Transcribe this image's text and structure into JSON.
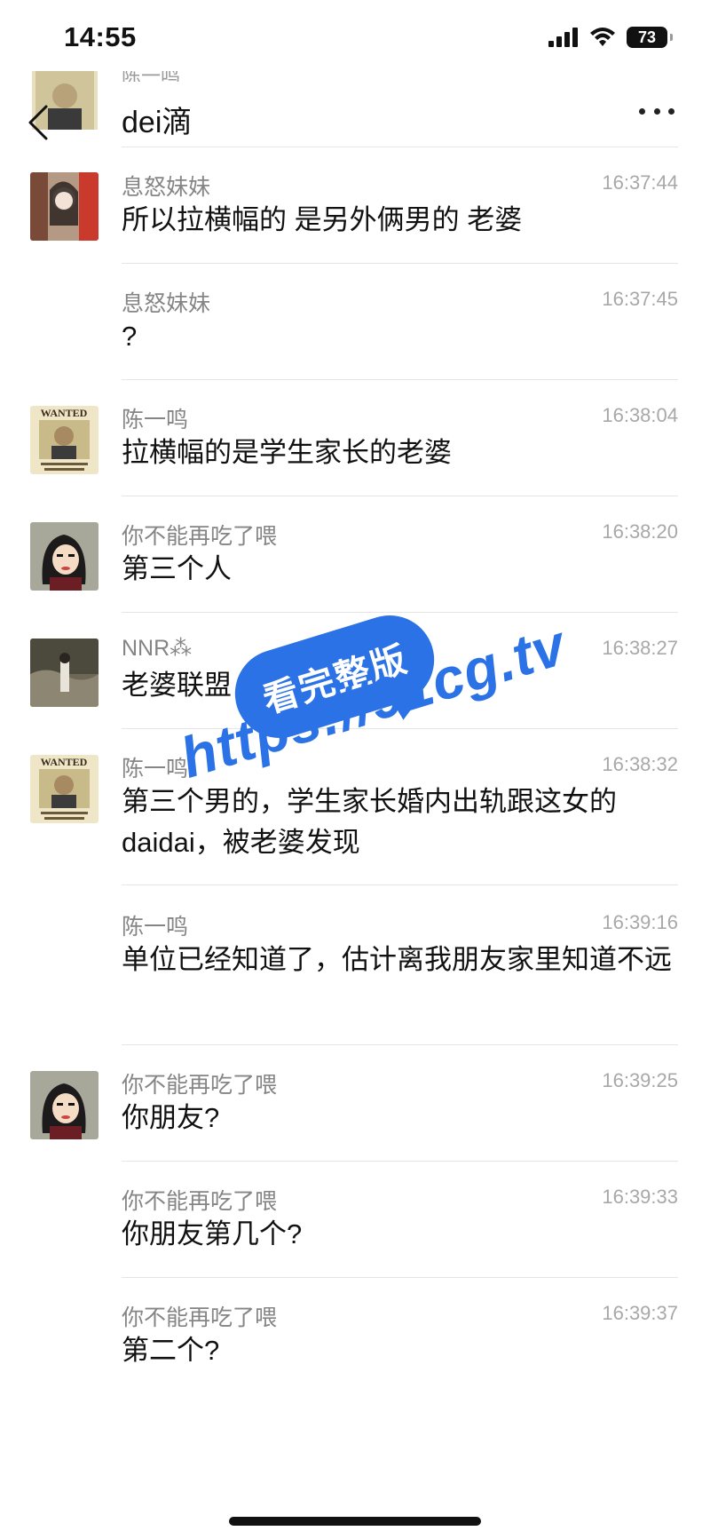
{
  "status_bar": {
    "time": "14:55",
    "battery": "73"
  },
  "header": {
    "title": "dei滴",
    "subtitle": "陈一鸣"
  },
  "messages": [
    {
      "sender": "息怒妹妹",
      "time": "16:37:44",
      "text": "所以拉横幅的 是另外俩男的 老婆",
      "avatar": "photo-avatar"
    },
    {
      "sender": "息怒妹妹",
      "time": "16:37:45",
      "text": "?",
      "avatar": ""
    },
    {
      "sender": "陈一鸣",
      "time": "16:38:04",
      "text": "拉横幅的是学生家长的老婆",
      "avatar": "wanted-poster-avatar"
    },
    {
      "sender": "你不能再吃了喂",
      "time": "16:38:20",
      "text": "第三个人",
      "avatar": "cartoon-avatar"
    },
    {
      "sender": "NNR⁂",
      "time": "16:38:27",
      "text": "老婆联盟",
      "avatar": "photo-avatar"
    },
    {
      "sender": "陈一鸣",
      "time": "16:38:32",
      "text": "第三个男的，学生家长婚内出轨跟这女的daidai，被老婆发现",
      "avatar": "wanted-poster-avatar"
    },
    {
      "sender": "陈一鸣",
      "time": "16:39:16",
      "text": "单位已经知道了，估计离我朋友家里知道不远",
      "avatar": ""
    },
    {
      "sender": "你不能再吃了喂",
      "time": "16:39:25",
      "text": "你朋友?",
      "avatar": "cartoon-avatar"
    },
    {
      "sender": "你不能再吃了喂",
      "time": "16:39:33",
      "text": "你朋友第几个?",
      "avatar": ""
    },
    {
      "sender": "你不能再吃了喂",
      "time": "16:39:37",
      "text": "第二个?",
      "avatar": ""
    }
  ],
  "watermark": {
    "badge": "看完整版",
    "url": "https://91cg.tv"
  }
}
